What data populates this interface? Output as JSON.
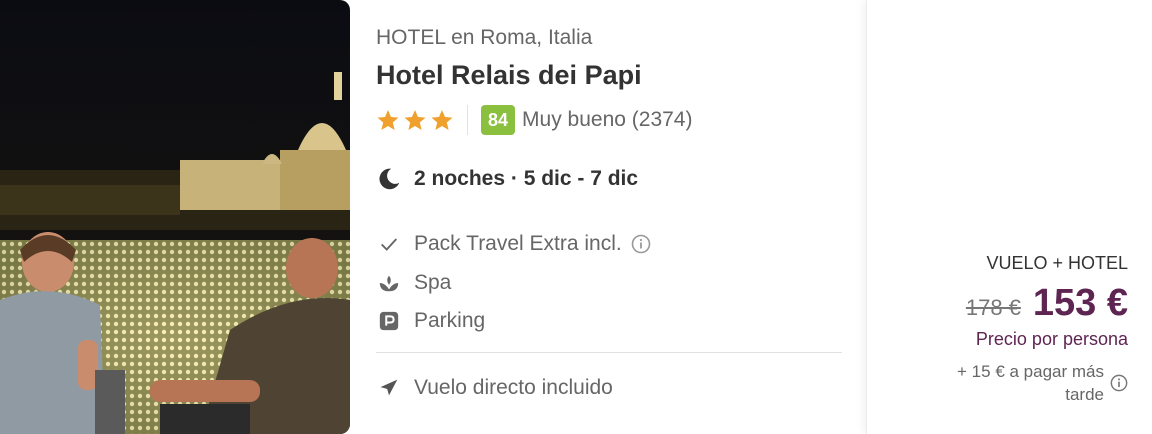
{
  "hotel": {
    "location": "HOTEL en Roma, Italia",
    "name": "Hotel Relais dei Papi",
    "stars": 3,
    "score": "84",
    "score_text": "Muy bueno (2374)",
    "stay": "2 noches · 5 dic - 7 dic"
  },
  "amenities": [
    {
      "icon": "check-icon",
      "label": "Pack Travel Extra incl."
    },
    {
      "icon": "spa-icon",
      "label": "Spa"
    },
    {
      "icon": "parking-icon",
      "label": "Parking"
    }
  ],
  "flight": {
    "icon": "plane-icon",
    "label": "Vuelo directo incluido"
  },
  "price": {
    "type": "VUELO + HOTEL",
    "old": "178 €",
    "new": "153 €",
    "per_person": "Precio por persona",
    "extra_fee": "+ 15 € a pagar más tarde"
  },
  "colors": {
    "score_badge": "#8bbf3e",
    "star": "#f0a02c",
    "price": "#5e2452"
  }
}
